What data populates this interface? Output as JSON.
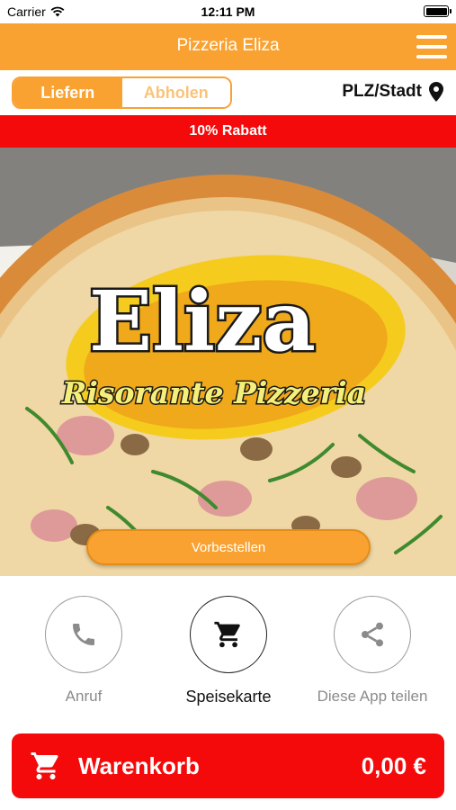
{
  "status_bar": {
    "carrier": "Carrier",
    "time": "12:11 PM"
  },
  "header": {
    "title": "Pizzeria Eliza"
  },
  "mode": {
    "deliver_label": "Liefern",
    "pickup_label": "Abholen",
    "location_label": "PLZ/Stadt"
  },
  "promo": {
    "text": "10% Rabatt"
  },
  "hero": {
    "logo_title": "Eliza",
    "logo_subtitle": "Risorante Pizzeria",
    "preorder_label": "Vorbestellen"
  },
  "actions": [
    {
      "label": "Anruf",
      "icon": "phone-icon"
    },
    {
      "label": "Speisekarte",
      "icon": "cart-icon"
    },
    {
      "label": "Diese App teilen",
      "icon": "share-icon"
    }
  ],
  "cart": {
    "label": "Warenkorb",
    "total": "0,00 €"
  },
  "colors": {
    "accent": "#f9a232",
    "alert": "#f40a0a",
    "muted": "#8b8b8b"
  }
}
